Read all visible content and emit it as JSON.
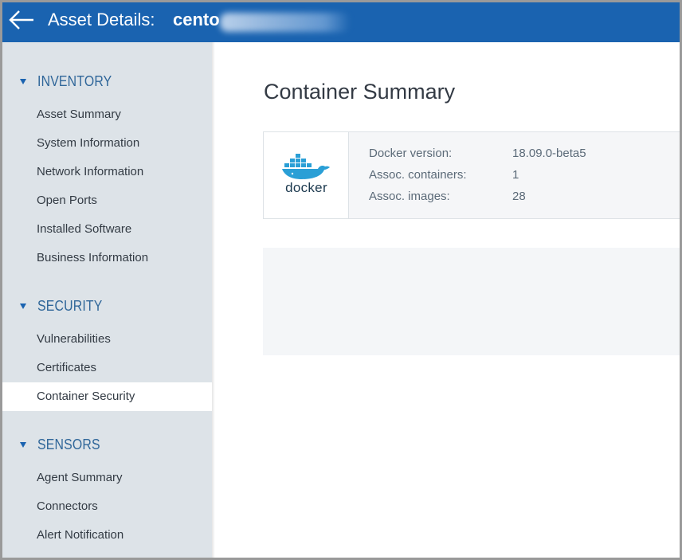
{
  "header": {
    "title_label": "Asset Details:",
    "asset_name": "cento",
    "back_icon": "arrow-left-icon"
  },
  "sidebar": {
    "sections": [
      {
        "title": "INVENTORY",
        "items": [
          "Asset Summary",
          "System Information",
          "Network Information",
          "Open Ports",
          "Installed Software",
          "Business Information"
        ]
      },
      {
        "title": "SECURITY",
        "items": [
          "Vulnerabilities",
          "Certificates",
          "Container Security"
        ]
      },
      {
        "title": "SENSORS",
        "items": [
          "Agent Summary",
          "Connectors",
          "Alert Notification"
        ]
      }
    ],
    "active_item": "Container Security"
  },
  "main": {
    "title": "Container Summary",
    "summary": {
      "logo_text": "docker",
      "fields": [
        {
          "label": "Docker version:",
          "value": "18.09.0-beta5"
        },
        {
          "label": "Assoc. containers:",
          "value": "1"
        },
        {
          "label": "Assoc. images:",
          "value": "28"
        }
      ]
    }
  },
  "colors": {
    "header_bg": "#1a63b0",
    "sidebar_bg": "#dde3e8",
    "section_title": "#2f6699",
    "docker_blue": "#2a9fd6"
  }
}
